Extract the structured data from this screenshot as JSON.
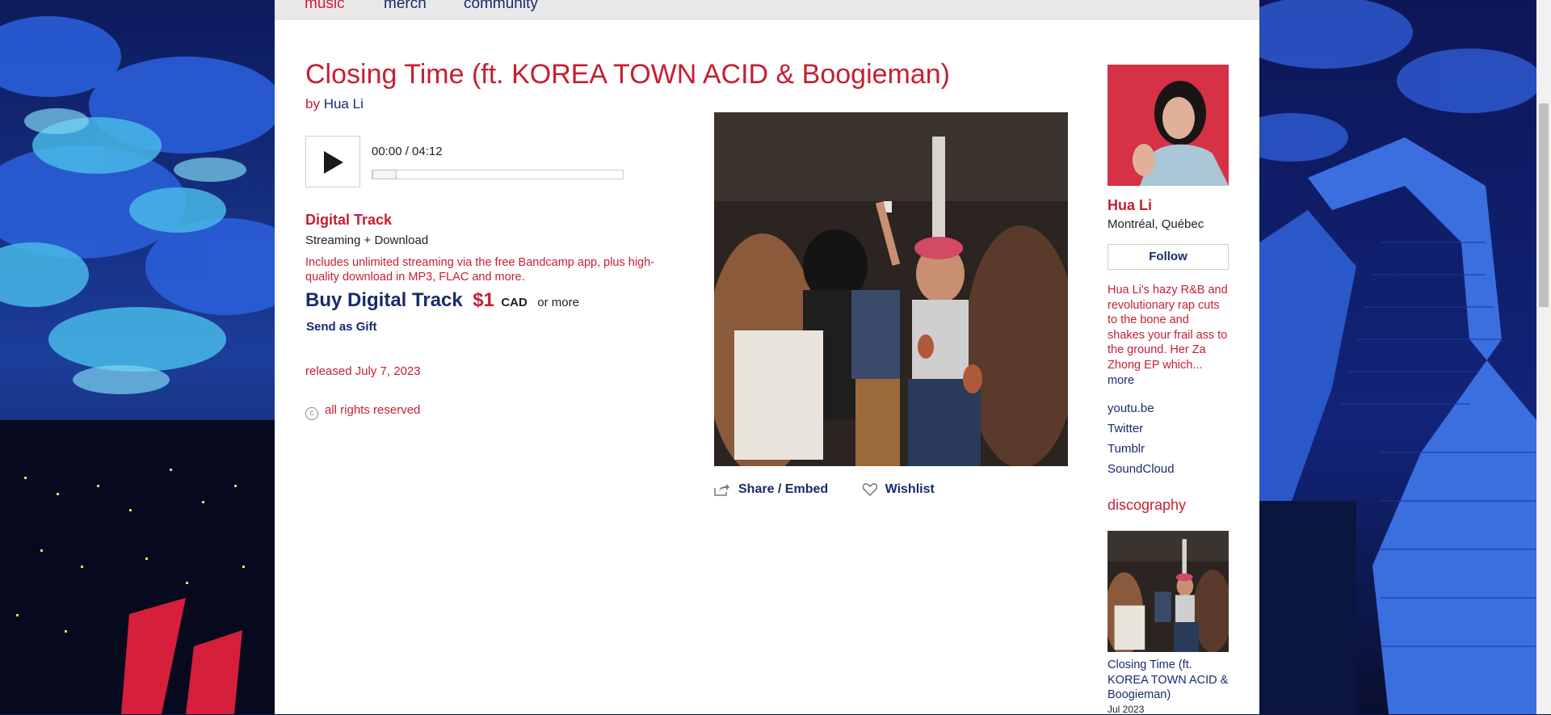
{
  "nav": {
    "music": "music",
    "merch": "merch",
    "community": "community"
  },
  "track": {
    "title": "Closing Time (ft. KOREA TOWN ACID & Boogieman)",
    "by_prefix": "by",
    "artist": "Hua Li"
  },
  "player": {
    "time": "00:00 / 04:12",
    "progress": 0.0
  },
  "purchase": {
    "format_title": "Digital Track",
    "format_sub": "Streaming + Download",
    "description": "Includes unlimited streaming via the free Bandcamp app, plus high-quality download in MP3, FLAC and more.",
    "buy_label": "Buy Digital Track",
    "price": "$1",
    "currency": "CAD",
    "or_more": "or more",
    "gift": "Send as Gift"
  },
  "meta": {
    "released": "released July 7, 2023",
    "rights": "all rights reserved"
  },
  "actions": {
    "share": "Share / Embed",
    "wishlist": "Wishlist"
  },
  "sidebar": {
    "band_name": "Hua Li",
    "location": "Montréal, Québec",
    "follow": "Follow",
    "bio": "Hua Li's hazy R&B and revolutionary rap cuts to the bone and shakes your frail ass to the ground. Her Za Zhong EP which...",
    "more": "more",
    "links": [
      "youtu.be",
      "Twitter",
      "Tumblr",
      "SoundCloud"
    ],
    "discography_title": "discography",
    "discography": [
      {
        "title": "Closing Time (ft. KOREA TOWN ACID & Boogieman)",
        "date": "Jul 2023"
      }
    ]
  },
  "colors": {
    "accent": "#c51f33",
    "link": "#1a2b6b",
    "nav_bg": "#e8e8e8"
  }
}
